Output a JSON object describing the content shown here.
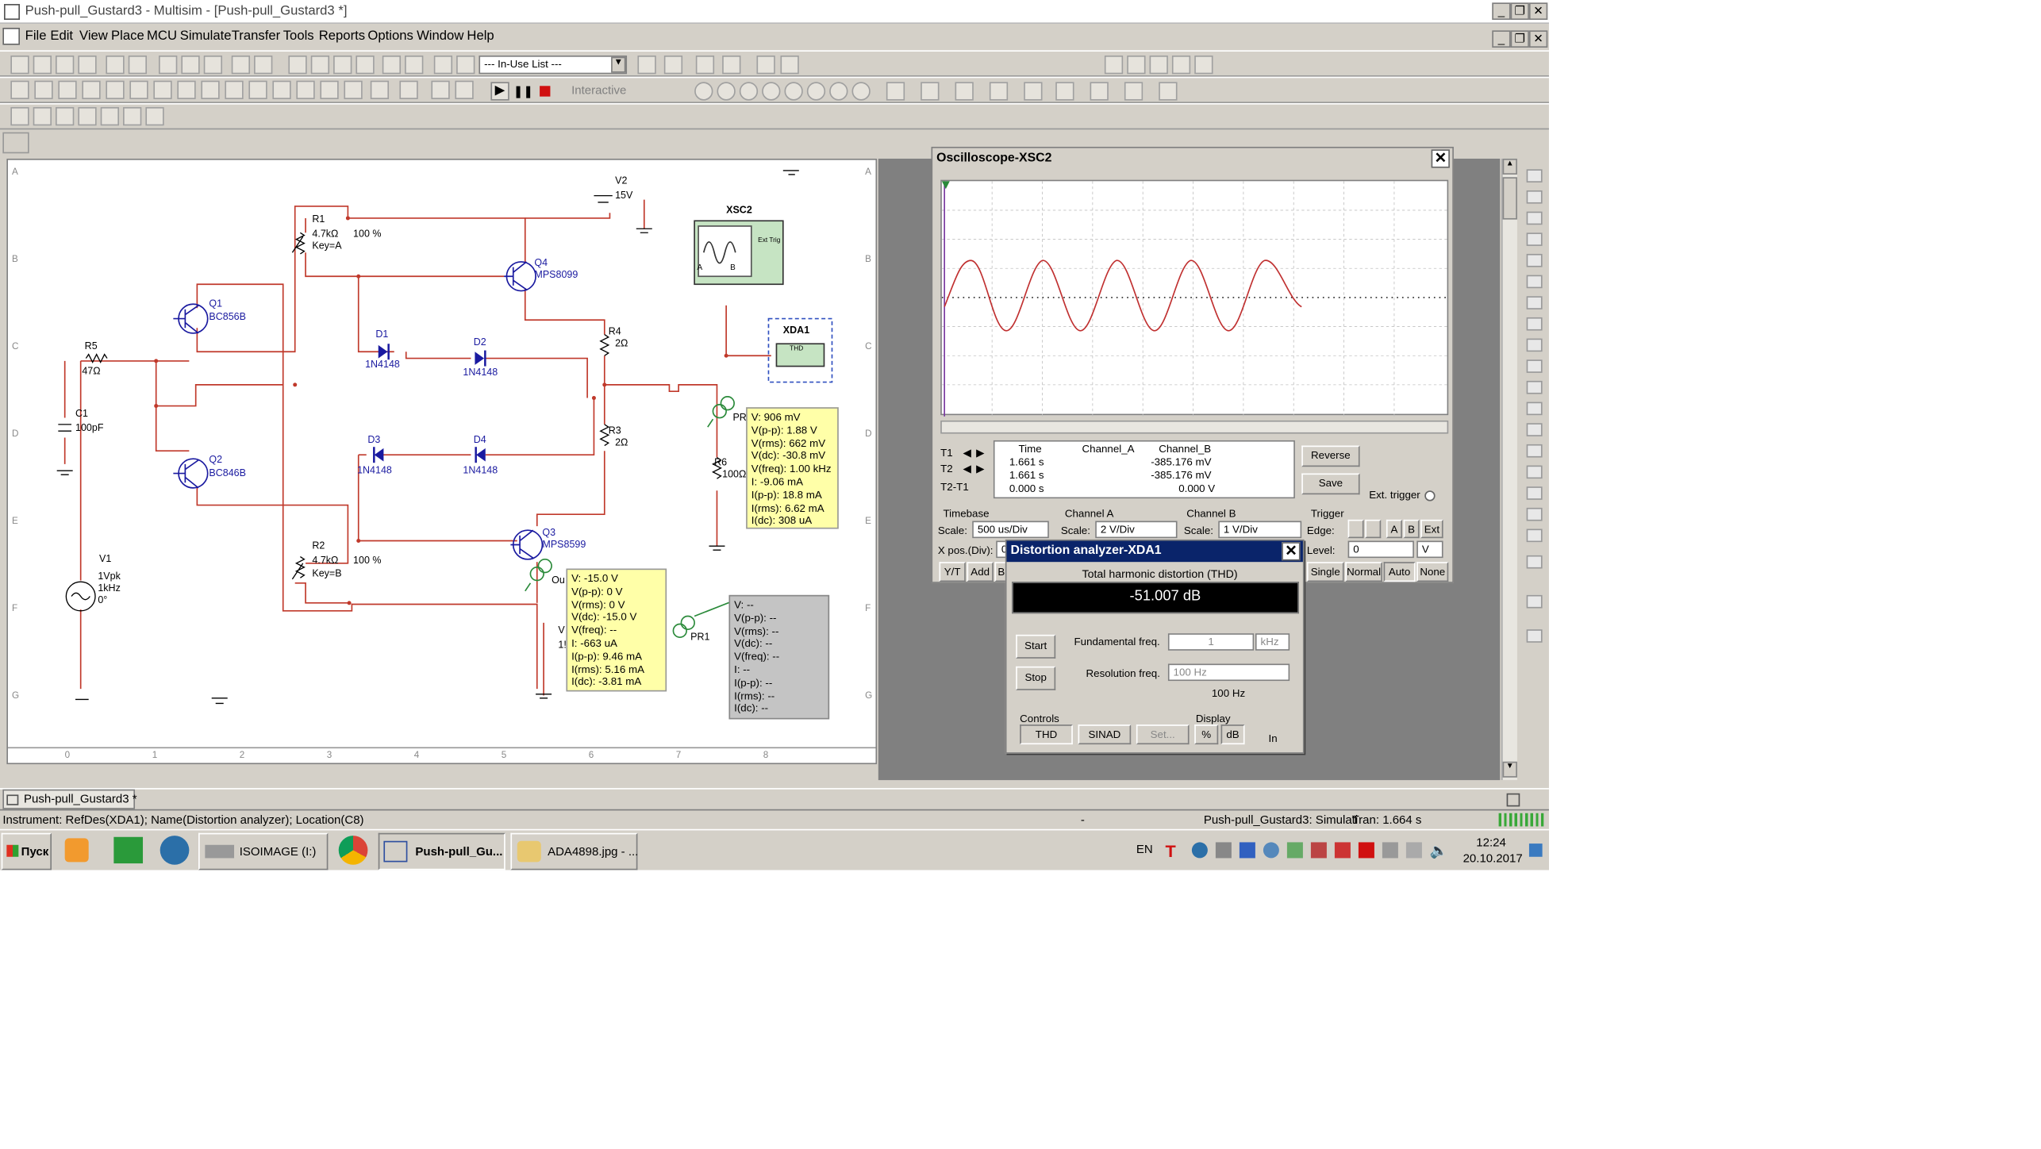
{
  "titlebar": {
    "title": "Push-pull_Gustard3 - Multisim - [Push-pull_Gustard3 *]"
  },
  "menu": [
    "File",
    "Edit",
    "View",
    "Place",
    "MCU",
    "Simulate",
    "Transfer",
    "Tools",
    "Reports",
    "Options",
    "Window",
    "Help"
  ],
  "toolbar": {
    "in_use_list": "--- In-Use List ---",
    "interactive": "Interactive"
  },
  "schematic": {
    "rows": [
      "A",
      "B",
      "C",
      "D",
      "E",
      "F",
      "G"
    ],
    "cols": [
      "0",
      "1",
      "2",
      "3",
      "4",
      "5",
      "6",
      "7",
      "8"
    ],
    "v2": {
      "ref": "V2",
      "val": "15V"
    },
    "r1": {
      "ref": "R1",
      "val": "4.7kΩ",
      "pct": "100 %",
      "key": "Key=A"
    },
    "r2": {
      "ref": "R2",
      "val": "4.7kΩ",
      "pct": "100 %",
      "key": "Key=B"
    },
    "q1": {
      "ref": "Q1",
      "part": "BC856B"
    },
    "q2": {
      "ref": "Q2",
      "part": "BC846B"
    },
    "q3": {
      "ref": "Q3",
      "part": "MPS8599"
    },
    "q4": {
      "ref": "Q4",
      "part": "MPS8099"
    },
    "r5": {
      "ref": "R5",
      "val": "47Ω"
    },
    "c1": {
      "ref": "C1",
      "val": "100pF"
    },
    "d1": {
      "ref": "D1",
      "part": "1N4148"
    },
    "d2": {
      "ref": "D2",
      "part": "1N4148"
    },
    "d3": {
      "ref": "D3",
      "part": "1N4148"
    },
    "d4": {
      "ref": "D4",
      "part": "1N4148"
    },
    "r4": {
      "ref": "R4",
      "val": "2Ω"
    },
    "r3": {
      "ref": "R3",
      "val": "2Ω"
    },
    "r6": {
      "ref": "R6",
      "val": "100Ω"
    },
    "v1": {
      "ref": "V1",
      "amp": "1Vpk",
      "freq": "1kHz",
      "phase": "0°"
    },
    "xsc2": {
      "ref": "XSC2",
      "a": "A",
      "b": "B",
      "ext": "Ext Trig"
    },
    "xda1": {
      "ref": "XDA1",
      "thd": "THD"
    },
    "pr1": "PR1",
    "pr": "PR",
    "out": "Ou",
    "probe_yellow": [
      "V: 906 mV",
      "V(p-p): 1.88 V",
      "V(rms): 662 mV",
      "V(dc): -30.8 mV",
      "V(freq): 1.00 kHz",
      "I: -9.06 mA",
      "I(p-p): 18.8 mA",
      "I(rms): 6.62 mA",
      "I(dc): 308 uA"
    ],
    "probe_yellow2": [
      "V: -15.0 V",
      "V(p-p): 0 V",
      "V(rms): 0 V",
      "V(dc): -15.0 V",
      "V(freq): --",
      "I: -663 uA",
      "I(p-p): 9.46 mA",
      "I(rms): 5.16 mA",
      "I(dc): -3.81 mA"
    ],
    "probe_gray": [
      "V: --",
      "V(p-p): --",
      "V(rms): --",
      "V(dc): --",
      "V(freq): --",
      "I: --",
      "I(p-p): --",
      "I(rms): --",
      "I(dc): --"
    ],
    "v3_frag": {
      "a": "V",
      "b": "1!"
    }
  },
  "oscilloscope": {
    "title": "Oscilloscope-XSC2",
    "table": {
      "headers": [
        "Time",
        "Channel_A",
        "Channel_B"
      ],
      "rows": [
        [
          "T1",
          "1.661 s",
          "",
          "-385.176 mV"
        ],
        [
          "T2",
          "1.661 s",
          "",
          "-385.176 mV"
        ],
        [
          "T2-T1",
          "0.000 s",
          "",
          "0.000 V"
        ]
      ]
    },
    "reverse": "Reverse",
    "save": "Save",
    "ext_trigger": "Ext. trigger",
    "timebase": {
      "label": "Timebase",
      "scale_label": "Scale:",
      "scale": "500 us/Div",
      "xpos_label": "X pos.(Div):",
      "xpos": "0",
      "yt": "Y/T",
      "add": "Add",
      "b": "B"
    },
    "channel_a": {
      "label": "Channel A",
      "scale_label": "Scale:",
      "scale": "2  V/Div"
    },
    "channel_b": {
      "label": "Channel B",
      "scale_label": "Scale:",
      "scale": "1  V/Div"
    },
    "trigger": {
      "label": "Trigger",
      "edge": "Edge:",
      "level": "Level:",
      "level_val": "0",
      "unit": "V",
      "a": "A",
      "b": "B",
      "ext": "Ext",
      "single": "Single",
      "normal": "Normal",
      "auto": "Auto",
      "none": "None"
    }
  },
  "distortion": {
    "title": "Distortion analyzer-XDA1",
    "thd_label": "Total harmonic distortion (THD)",
    "value": "-51.007 dB",
    "start": "Start",
    "stop": "Stop",
    "fund_label": "Fundamental freq.",
    "fund_val": "1",
    "fund_unit": "kHz",
    "res_label": "Resolution freq.",
    "res_val": "100 Hz",
    "res_box": "100 Hz",
    "controls": "Controls",
    "thd": "THD",
    "sinad": "SINAD",
    "set": "Set...",
    "display": "Display",
    "pct": "%",
    "db": "dB",
    "in": "In"
  },
  "tab": "Push-pull_Gustard3 *",
  "status": {
    "left": "Instrument: RefDes(XDA1); Name(Distortion analyzer); Location(C8)",
    "mid": "-",
    "sim": "Push-pull_Gustard3: Simulati",
    "tran": "Tran: 1.664 s"
  },
  "taskbar": {
    "start": "Пуск",
    "isoimage": "ISOIMAGE (I:)",
    "multisim": "Push-pull_Gu...",
    "ada": "ADA4898.jpg - ...",
    "lang": "EN",
    "time": "12:24",
    "date": "20.10.2017"
  }
}
